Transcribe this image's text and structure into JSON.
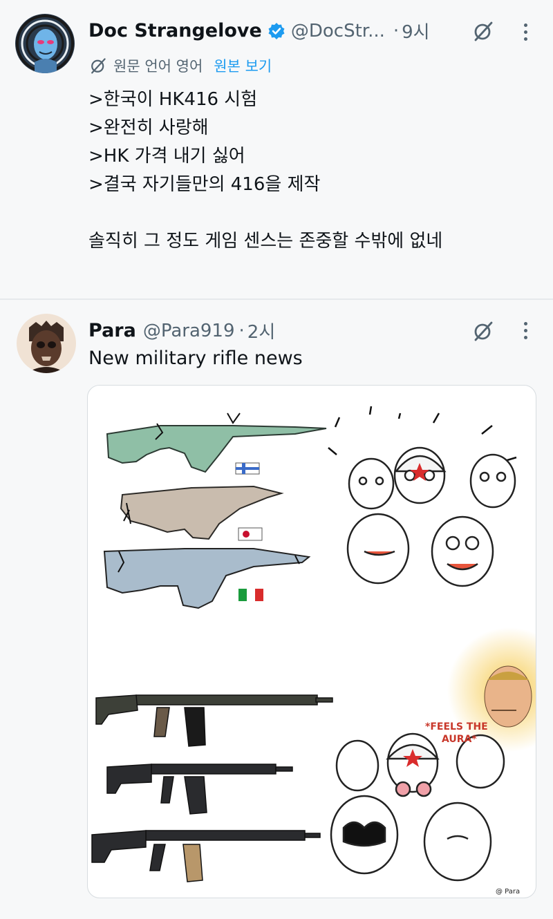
{
  "post1": {
    "author_name": "Doc Strangelove",
    "handle": "@DocStr...",
    "dot": "·",
    "time": "9시",
    "translate_status": "원문 언어 영어",
    "show_original": "원본 보기",
    "lines": [
      ">한국이 HK416 시험",
      ">완전히 사랑해",
      ">HK 가격 내기 싫어",
      ">결국 자기들만의 416을 제작"
    ],
    "closing_line": "솔직히 그 정도 게임 센스는 존중할 수밖에 없네"
  },
  "post2": {
    "author_name": "Para",
    "handle": "@Para919",
    "dot": "·",
    "time": "2시",
    "text": "New military rifle news",
    "media": {
      "caption_feels": "*FEELS THE",
      "caption_aura": "AURA*",
      "signature": "@ Para"
    }
  },
  "colors": {
    "verified": "#1d9bf0",
    "secondary_text": "#536471",
    "link": "#1d9bf0"
  },
  "icons": [
    "verified-badge-icon",
    "grok-icon",
    "more-icon",
    "translate-icon"
  ]
}
